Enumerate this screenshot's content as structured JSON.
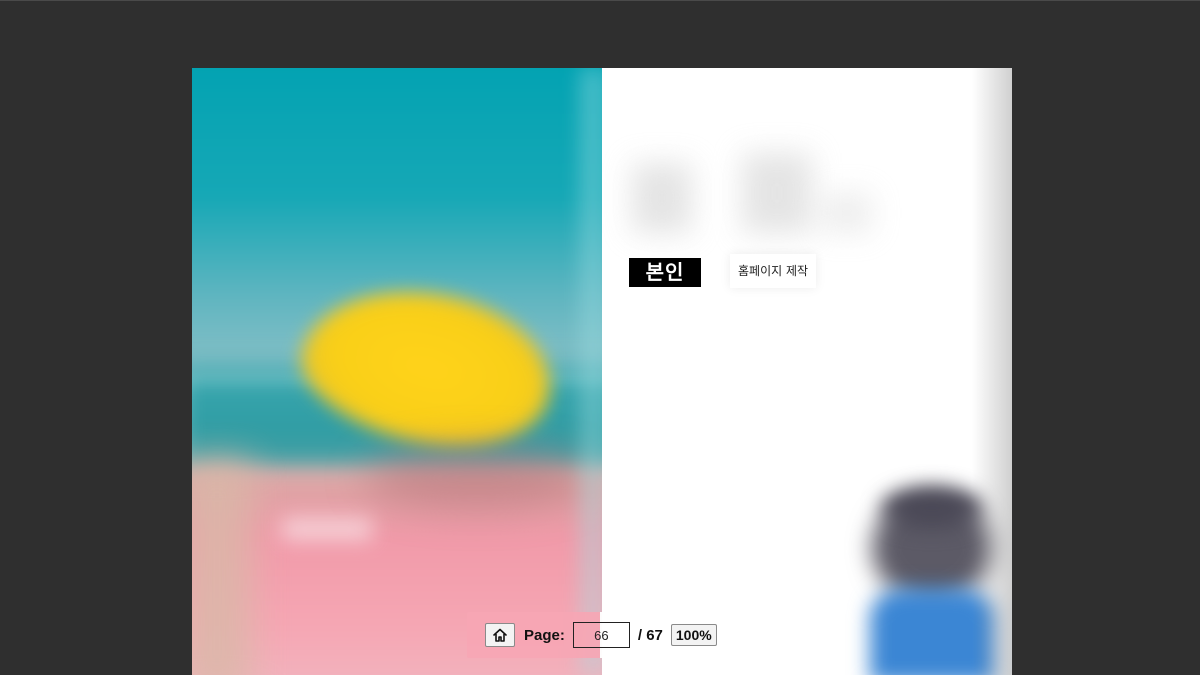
{
  "page_content": {
    "name_badge": "본인",
    "homepage_label": "홈페이지 제작"
  },
  "toolbar": {
    "home_icon": "home-icon",
    "page_label": "Page:",
    "current_page": "66",
    "total_pages": "/ 67",
    "zoom_label": "100%"
  },
  "colors": {
    "viewer_background": "#2f2f2f",
    "art_teal": "#00a2b2",
    "art_yellow": "#ffd31a",
    "art_pink": "#f6a7b4",
    "toolbar_pink": "#f6a6b4",
    "badge_black": "#000000"
  }
}
